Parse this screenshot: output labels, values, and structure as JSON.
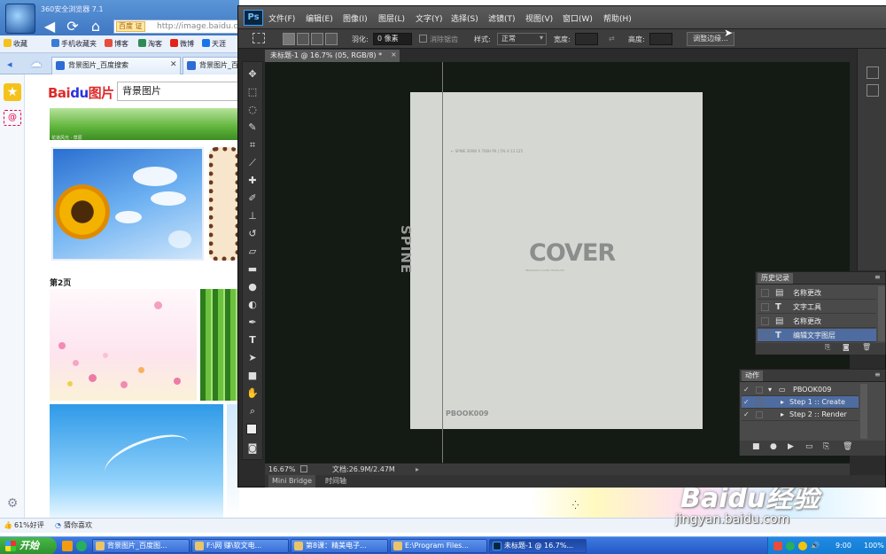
{
  "browser": {
    "title": "360安全浏览器 7.1",
    "url_badge": "百度 证",
    "url": "http://image.baidu.co",
    "favorites": [
      {
        "label": "收藏",
        "color": "#f5c21b"
      },
      {
        "label": "手机收藏夹",
        "color": "#3a7bd5"
      },
      {
        "label": "博客",
        "color": "#e74c3c"
      },
      {
        "label": "淘客",
        "color": "#2e8b57"
      },
      {
        "label": "微博",
        "color": "#e2231a"
      },
      {
        "label": "天涯",
        "color": "#1a73e8"
      }
    ],
    "tabs": [
      {
        "label": "背景图片_百度搜索"
      },
      {
        "label": "背景图片_百"
      }
    ],
    "page": {
      "logo_red": "Bai",
      "logo_blue": "du",
      "logo_suffix": "图片",
      "search_value": "背景图片",
      "grass_caption": "花道风光 · 草原",
      "page2_label": "第2页"
    },
    "status": {
      "left": "61%好评",
      "right": "猜你喜欢"
    }
  },
  "photoshop": {
    "logo": "Ps",
    "menu": [
      "文件(F)",
      "编辑(E)",
      "图像(I)",
      "图层(L)",
      "文字(Y)",
      "选择(S)",
      "滤镜(T)",
      "视图(V)",
      "窗口(W)",
      "帮助(H)"
    ],
    "options": {
      "feather_label": "羽化:",
      "feather_value": "0 像素",
      "antialias_label": "消除锯齿",
      "style_label": "样式:",
      "style_value": "正常",
      "width_label": "宽度:",
      "height_label": "高度:",
      "refine_label": "调整边缘..."
    },
    "document_tab": "未标题-1 @ 16.7% (05, RGB/8) *",
    "canvas": {
      "cover_title": "COVER",
      "spine_label": "SPINE",
      "size_note": "← SPINE 300W X 700H PX | 5% X 13 125",
      "cover_sub": "PBOOK009 COVER TEMPLATE",
      "book_label": "PBOOK009"
    },
    "status_zoom": "16.67%",
    "status_doc": "文档:26.9M/2.47M",
    "bottom_tabs": [
      "Mini Bridge",
      "时间轴"
    ],
    "history": {
      "title": "历史记录",
      "items": [
        {
          "icon": "doc",
          "label": "名称更改",
          "selected": false
        },
        {
          "icon": "T",
          "label": "文字工具",
          "selected": false
        },
        {
          "icon": "doc",
          "label": "名称更改",
          "selected": false
        },
        {
          "icon": "T",
          "label": "编辑文字图层",
          "selected": true
        }
      ]
    },
    "actions": {
      "title": "动作",
      "set_label": "PBOOK009",
      "steps": [
        {
          "label": "Step 1 :: Create",
          "selected": true
        },
        {
          "label": "Step 2 :: Render",
          "selected": false
        }
      ]
    }
  },
  "watermark": {
    "brand": "Baidu经验",
    "url": "jingyan.baidu.com"
  },
  "taskbar": {
    "start": "开始",
    "items": [
      {
        "label": "背景图片_百度图...",
        "active": false
      },
      {
        "label": "F:\\网  赚\\软文电...",
        "active": false
      },
      {
        "label": "第8课：精美电子...",
        "active": false
      },
      {
        "label": "E:\\Program Files...",
        "active": false
      },
      {
        "label": "未标题-1 @ 16.7%...",
        "active": true
      }
    ],
    "clock": "9:00",
    "tray_text": "100%"
  }
}
